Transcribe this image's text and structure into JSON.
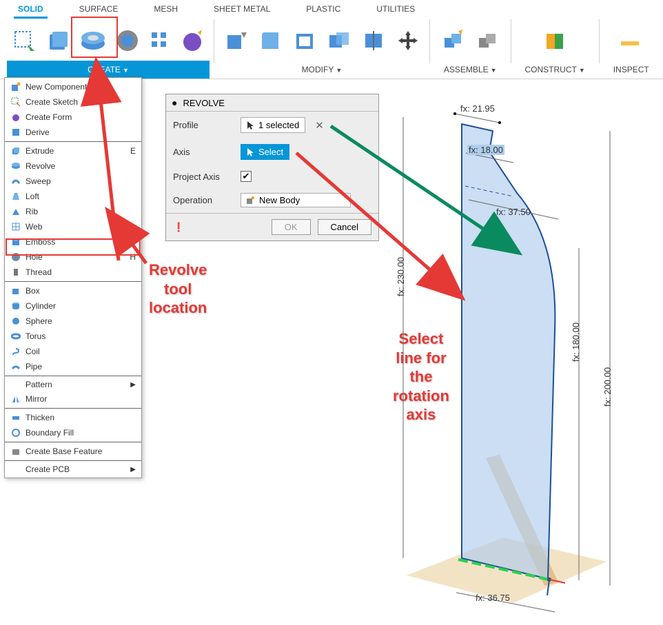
{
  "tabs": {
    "solid": "SOLID",
    "surface": "SURFACE",
    "mesh": "MESH",
    "sheet_metal": "SHEET METAL",
    "plastic": "PLASTIC",
    "utilities": "UTILITIES"
  },
  "toolbar_groups": {
    "create": "CREATE",
    "modify": "MODIFY",
    "assemble": "ASSEMBLE",
    "construct": "CONSTRUCT",
    "inspect": "INSPECT"
  },
  "create_menu": {
    "new_component": "New Component",
    "create_sketch": "Create Sketch",
    "create_form": "Create Form",
    "derive": "Derive",
    "extrude": "Extrude",
    "extrude_key": "E",
    "revolve": "Revolve",
    "sweep": "Sweep",
    "loft": "Loft",
    "rib": "Rib",
    "web": "Web",
    "emboss": "Emboss",
    "hole": "Hole",
    "hole_key": "H",
    "thread": "Thread",
    "box": "Box",
    "cylinder": "Cylinder",
    "sphere": "Sphere",
    "torus": "Torus",
    "coil": "Coil",
    "pipe": "Pipe",
    "pattern": "Pattern",
    "mirror": "Mirror",
    "thicken": "Thicken",
    "boundary_fill": "Boundary Fill",
    "create_base": "Create Base Feature",
    "create_pcb": "Create PCB"
  },
  "panel": {
    "title": "REVOLVE",
    "profile_label": "Profile",
    "profile_value": "1 selected",
    "axis_label": "Axis",
    "axis_value": "Select",
    "project_axis_label": "Project Axis",
    "operation_label": "Operation",
    "operation_value": "New Body",
    "info": "❗",
    "ok": "OK",
    "cancel": "Cancel"
  },
  "annotations": {
    "tool_location": "Revolve\ntool\nlocation",
    "select_axis": "Select\nline for\nthe\nrotation\naxis"
  },
  "dimensions": {
    "d1": "fx: 21.95",
    "d2": "fx: 18.00",
    "d3": "fx: 37.50",
    "d4": "fx: 230.00",
    "d5": "fx: 180.00",
    "d6": "fx: 200.00",
    "d7": "fx: 36.75"
  }
}
